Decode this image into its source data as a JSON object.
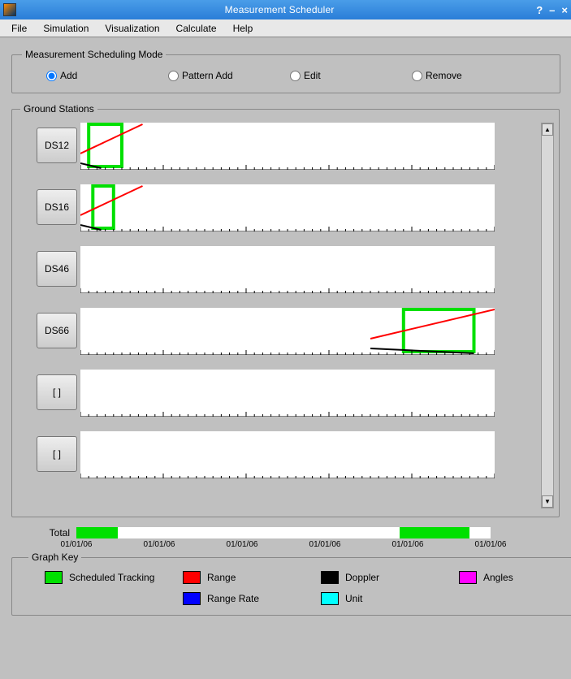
{
  "window": {
    "title": "Measurement Scheduler",
    "btns": {
      "help": "?",
      "min": "–",
      "close": "×"
    }
  },
  "menu": {
    "file": "File",
    "simulation": "Simulation",
    "visualization": "Visualization",
    "calculate": "Calculate",
    "help": "Help"
  },
  "mode": {
    "legend": "Measurement Scheduling Mode",
    "add": "Add",
    "pattern_add": "Pattern Add",
    "edit": "Edit",
    "remove": "Remove",
    "selected": "add"
  },
  "ground_stations": {
    "legend": "Ground Stations",
    "stations": [
      {
        "label": "DS12"
      },
      {
        "label": "DS16"
      },
      {
        "label": "DS46"
      },
      {
        "label": "DS66"
      },
      {
        "label": "[ ]"
      },
      {
        "label": "[ ]"
      }
    ]
  },
  "total": {
    "label": "Total",
    "axis": [
      "01/01/06",
      "01/01/06",
      "01/01/06",
      "01/01/06",
      "01/01/06",
      "01/01/06"
    ]
  },
  "key": {
    "legend": "Graph Key",
    "items": {
      "scheduled": "Scheduled Tracking",
      "range": "Range",
      "doppler": "Doppler",
      "angles": "Angles",
      "range_rate": "Range Rate",
      "unit": "Unit"
    }
  },
  "chart_data": {
    "type": "timeline",
    "x_axis_ticks": [
      "01/01/06",
      "01/01/06",
      "01/01/06",
      "01/01/06",
      "01/01/06",
      "01/01/06"
    ],
    "series_colors": {
      "scheduled_tracking": "#00e000",
      "range": "#ff0000",
      "doppler": "#000000",
      "angles": "#ff00ff",
      "range_rate": "#0000ff",
      "unit": "#00ffff"
    },
    "stations": [
      {
        "name": "DS12",
        "scheduled_window_pct": [
          2,
          10
        ],
        "range_line_pct": [
          0,
          15
        ],
        "doppler_line_pct": [
          0,
          5
        ]
      },
      {
        "name": "DS16",
        "scheduled_window_pct": [
          3,
          8
        ],
        "range_line_pct": [
          0,
          15
        ],
        "doppler_line_pct": [
          0,
          5
        ]
      },
      {
        "name": "DS46",
        "scheduled_window_pct": null,
        "range_line_pct": null,
        "doppler_line_pct": null
      },
      {
        "name": "DS66",
        "scheduled_window_pct": [
          78,
          95
        ],
        "range_line_pct": [
          70,
          100
        ],
        "doppler_line_pct": [
          70,
          95
        ]
      },
      {
        "name": "[ ]",
        "scheduled_window_pct": null,
        "range_line_pct": null,
        "doppler_line_pct": null
      },
      {
        "name": "[ ]",
        "scheduled_window_pct": null,
        "range_line_pct": null,
        "doppler_line_pct": null
      }
    ],
    "total_segments_pct": [
      [
        0,
        10
      ],
      [
        78,
        95
      ]
    ]
  }
}
